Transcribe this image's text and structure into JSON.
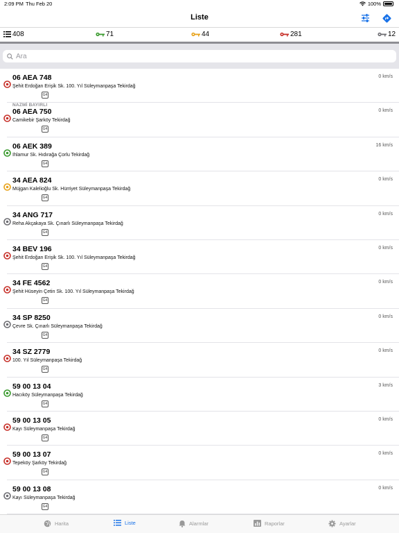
{
  "status_bar": {
    "time": "2:09 PM",
    "date": "Thu Feb 20",
    "battery": "100%"
  },
  "navbar": {
    "title": "Liste",
    "filter_icon": "sliders-icon",
    "route_icon": "directions-icon"
  },
  "counts": {
    "all": "408",
    "green": "71",
    "orange": "44",
    "red": "281",
    "gray": "12"
  },
  "colors": {
    "green": "#3a9a2e",
    "orange": "#e8a21a",
    "red": "#c7312a",
    "gray": "#6e6e73",
    "accent": "#1a73e8"
  },
  "search": {
    "placeholder": "Ara"
  },
  "vehicles": [
    {
      "plate": "06 AEA 748",
      "address": "Şehit Erdoğan Erişik Sk. 100. Yıl Süleymanpaşa Tekirdağ",
      "speed": "0 km/s",
      "badge": "G4",
      "status": "red",
      "tag": ""
    },
    {
      "plate": "06 AEA 750",
      "address": "Camikebir Şarköy Tekirdağ",
      "speed": "0 km/s",
      "badge": "G4",
      "status": "red",
      "tag": "NAZMİ BAYIRLI"
    },
    {
      "plate": "06 AEK 389",
      "address": "Ihlamur Sk. Hıdırağa Çorlu Tekirdağ",
      "speed": "16 km/s",
      "badge": "G4",
      "status": "green",
      "tag": ""
    },
    {
      "plate": "34 AEA 824",
      "address": "Müjgan Kalelioğlu Sk. Hürriyet Süleymanpaşa Tekirdağ",
      "speed": "0 km/s",
      "badge": "G4",
      "status": "orange",
      "tag": ""
    },
    {
      "plate": "34 ANG 717",
      "address": "Reha Akçakaya Sk. Çınarlı Süleymanpaşa Tekirdağ",
      "speed": "0 km/s",
      "badge": "G4",
      "status": "gray",
      "tag": ""
    },
    {
      "plate": "34 BEV 196",
      "address": "Şehit Erdoğan Erişik Sk. 100. Yıl Süleymanpaşa Tekirdağ",
      "speed": "0 km/s",
      "badge": "G4",
      "status": "red",
      "tag": ""
    },
    {
      "plate": "34 FE 4562",
      "address": "Şehit Hüseyin Çetin Sk. 100. Yıl Süleymanpaşa Tekirdağ",
      "speed": "0 km/s",
      "badge": "G4",
      "status": "red",
      "tag": ""
    },
    {
      "plate": "34 SP 8250",
      "address": "Çevre Sk. Çınarlı Süleymanpaşa Tekirdağ",
      "speed": "0 km/s",
      "badge": "G4",
      "status": "gray",
      "tag": ""
    },
    {
      "plate": "34 SZ 2779",
      "address": "100. Yıl Süleymanpaşa Tekirdağ",
      "speed": "0 km/s",
      "badge": "G4",
      "status": "red",
      "tag": ""
    },
    {
      "plate": "59 00 13 04",
      "address": "Hacıköy Süleymanpaşa Tekirdağ",
      "speed": "3 km/s",
      "badge": "G4",
      "status": "green",
      "tag": ""
    },
    {
      "plate": "59 00 13 05",
      "address": "Kayı Süleymanpaşa Tekirdağ",
      "speed": "0 km/s",
      "badge": "G4",
      "status": "red",
      "tag": ""
    },
    {
      "plate": "59 00 13 07",
      "address": "Tepeköy Şarköy Tekirdağ",
      "speed": "0 km/s",
      "badge": "G4",
      "status": "red",
      "tag": ""
    },
    {
      "plate": "59 00 13 08",
      "address": "Kayı Süleymanpaşa Tekirdağ",
      "speed": "0 km/s",
      "badge": "G4",
      "status": "gray",
      "tag": ""
    }
  ],
  "tabs": [
    {
      "label": "Harita",
      "icon": "globe-icon",
      "active": false
    },
    {
      "label": "Liste",
      "icon": "list-icon",
      "active": true
    },
    {
      "label": "Alarmlar",
      "icon": "bell-icon",
      "active": false
    },
    {
      "label": "Raporlar",
      "icon": "chart-icon",
      "active": false
    },
    {
      "label": "Ayarlar",
      "icon": "gear-icon",
      "active": false
    }
  ]
}
